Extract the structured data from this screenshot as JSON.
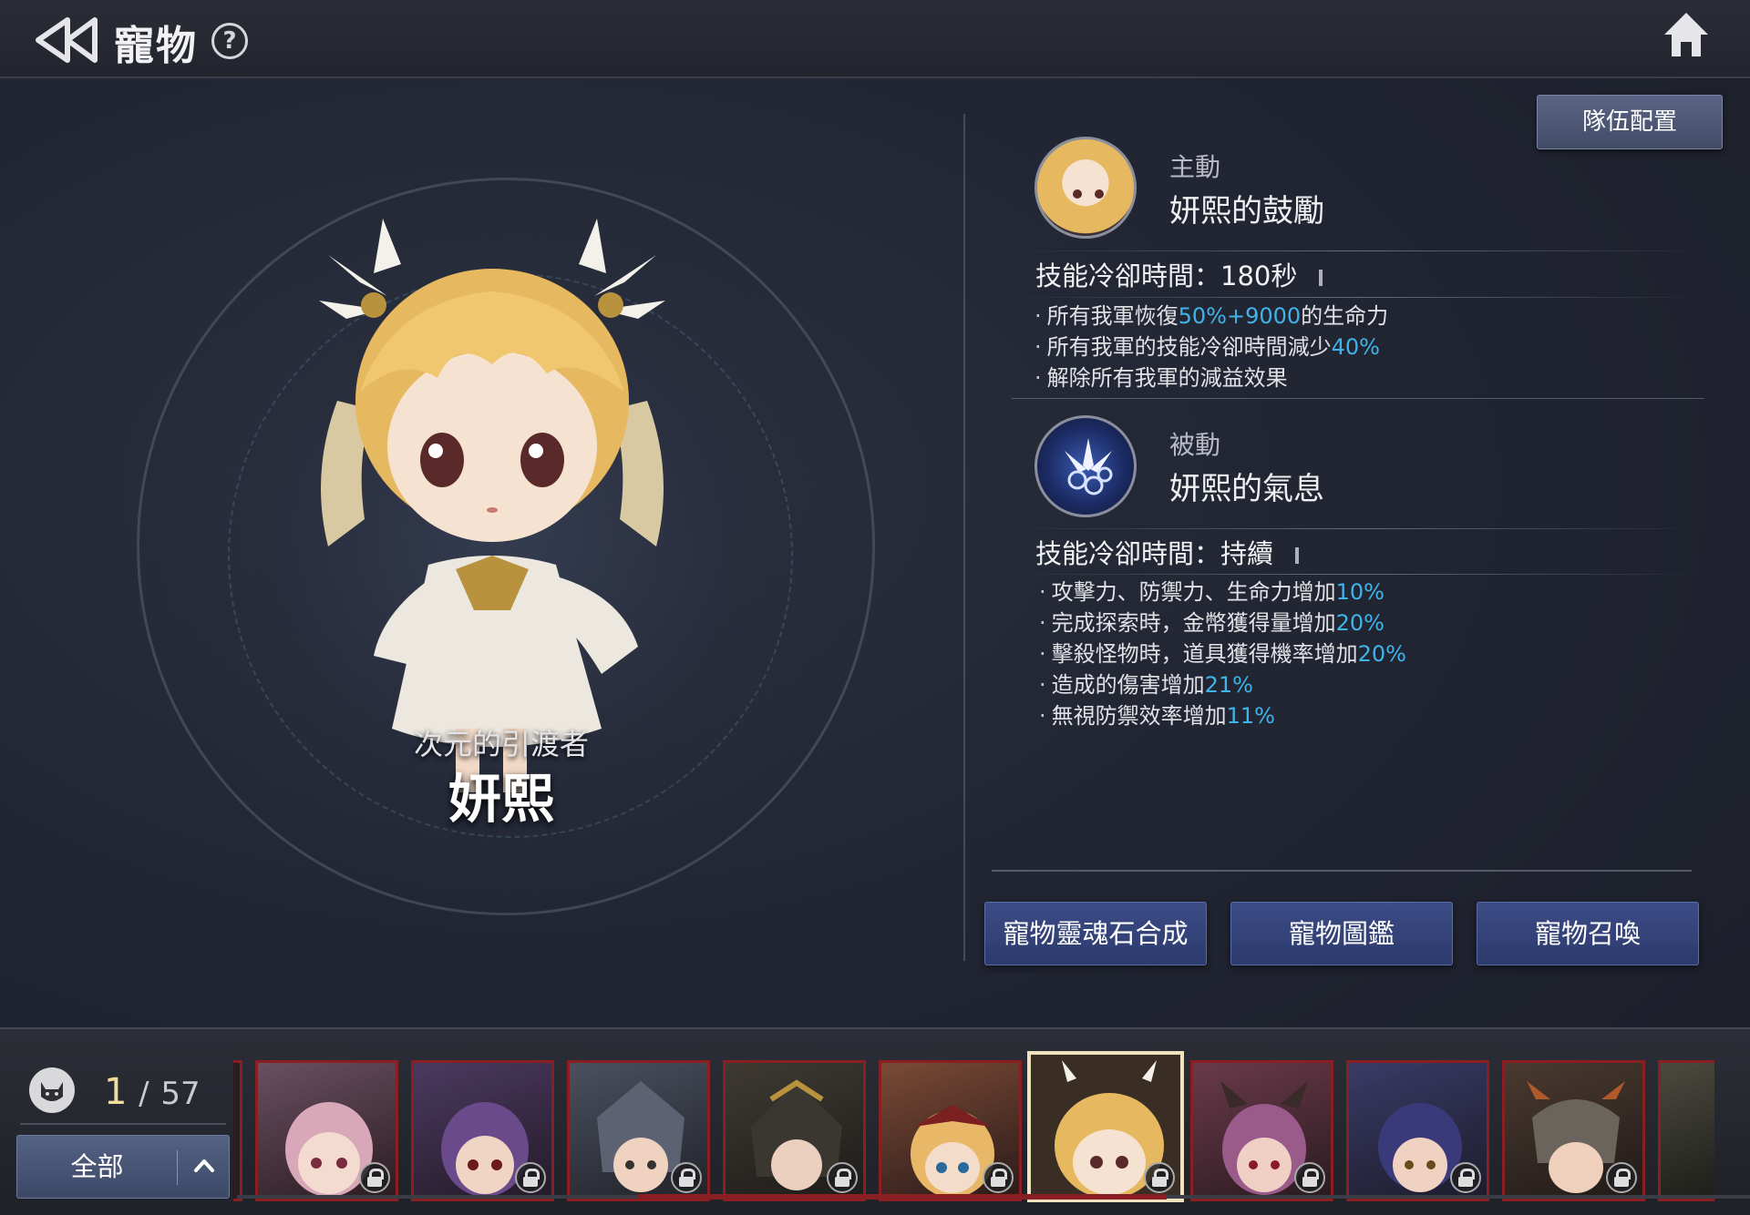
{
  "header": {
    "title": "寵物",
    "help_label": "?"
  },
  "pet": {
    "subtitle": "次元的引渡者",
    "name": "妍熙"
  },
  "team_button": "隊伍配置",
  "skills": [
    {
      "type": "主動",
      "name": "妍熙的鼓勵",
      "cooldown": "技能冷卻時間：180秒",
      "effects": [
        {
          "pre": "所有我軍恢復",
          "hl": "50%+9000",
          "post": "的生命力"
        },
        {
          "pre": "所有我軍的技能冷卻時間減少",
          "hl": "40%",
          "post": ""
        },
        {
          "pre": "解除所有我軍的減益效果",
          "hl": "",
          "post": ""
        }
      ]
    },
    {
      "type": "被動",
      "name": "妍熙的氣息",
      "cooldown": "技能冷卻時間：持續",
      "effects": [
        {
          "pre": "攻擊力、防禦力、生命力增加",
          "hl": "10%",
          "post": ""
        },
        {
          "pre": "完成探索時，金幣獲得量增加",
          "hl": "20%",
          "post": ""
        },
        {
          "pre": "擊殺怪物時，道具獲得機率增加",
          "hl": "20%",
          "post": ""
        },
        {
          "pre": "造成的傷害增加",
          "hl": "21%",
          "post": ""
        },
        {
          "pre": "無視防禦效率增加",
          "hl": "11%",
          "post": ""
        }
      ]
    }
  ],
  "actions": [
    "寵物靈魂石合成",
    "寵物圖鑑",
    "寵物召喚"
  ],
  "pet_list": {
    "current": "1",
    "separator": "/",
    "total": "57",
    "filter_label": "全部"
  },
  "colors": {
    "highlight": "#3fb4ea",
    "card_border": "#8a1f23",
    "selected_border": "#f0e2bf",
    "action_button": "#34437a"
  },
  "icons": [
    "back-arrow-icon",
    "help-icon",
    "home-icon",
    "pet-category-icon",
    "chevron-up-icon",
    "lock-icon"
  ]
}
